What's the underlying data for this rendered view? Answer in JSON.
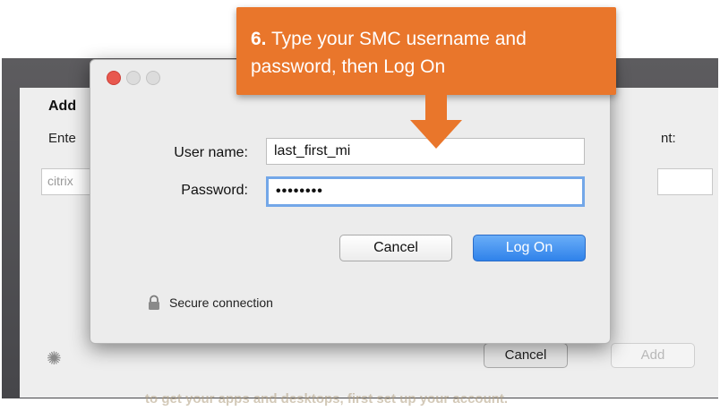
{
  "background_window": {
    "heading": "Add",
    "enter_text": "Ente",
    "enter_right_text": "nt:",
    "url_input_text": "citrix",
    "spinner_icon": "spinner-icon",
    "cancel_label": "Cancel",
    "add_label": "Add",
    "bottom_text": "to get your apps and desktops, first set up your account."
  },
  "dialog": {
    "username_label": "User name:",
    "username_value": "last_first_mi",
    "password_label": "Password:",
    "password_value": "••••••••",
    "cancel_label": "Cancel",
    "logon_label": "Log On",
    "secure_text": "Secure connection",
    "lock_icon": "lock-icon"
  },
  "callout": {
    "step": "6.",
    "text": "Type your SMC username and password, then Log On",
    "color": "#e9762b",
    "arrow_icon": "arrow-down-icon"
  },
  "colors": {
    "accent_blue": "#3d8bf0",
    "close_red": "#e8584e",
    "focus_ring": "#73a7e8"
  }
}
